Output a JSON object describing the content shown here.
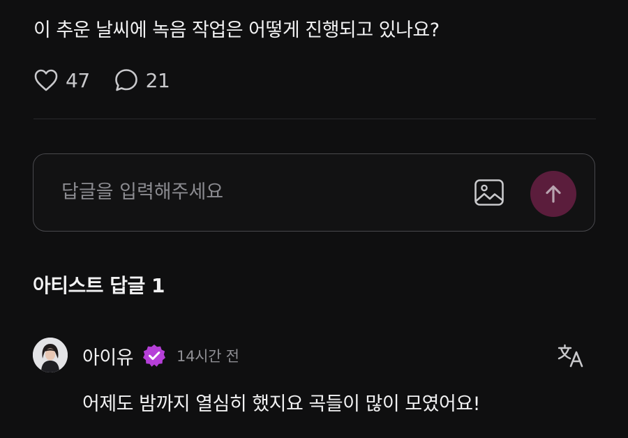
{
  "post": {
    "question": "이 추운 날씨에 녹음 작업은 어떻게 진행되고 있나요?",
    "likes": "47",
    "comments": "21"
  },
  "reply": {
    "placeholder": "답글을 입력해주세요",
    "image_icon": "image-icon",
    "send_icon": "arrow-up-icon",
    "send_color": "#5b1d3c"
  },
  "artist_replies": {
    "title": "아티스트 답글 1",
    "items": [
      {
        "author": "아이유",
        "verified_color": "#b53fd8",
        "time": "14시간 전",
        "text": "어제도 밤까지 열심히 했지요 곡들이 많이 모였어요!"
      }
    ]
  }
}
